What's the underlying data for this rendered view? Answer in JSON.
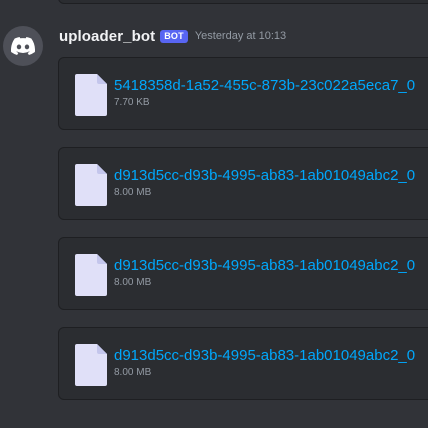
{
  "message": {
    "username": "uploader_bot",
    "bot_tag": "BOT",
    "timestamp": "Yesterday at 10:13",
    "avatar_icon": "discord-logo-icon",
    "attachments": [
      {
        "name": "5418358d-1a52-455c-873b-23c022a5eca7_0",
        "size": "7.70 KB",
        "icon": "file-icon"
      },
      {
        "name": "d913d5cc-d93b-4995-ab83-1ab01049abc2_0",
        "size": "8.00 MB",
        "icon": "file-icon"
      },
      {
        "name": "d913d5cc-d93b-4995-ab83-1ab01049abc2_0",
        "size": "8.00 MB",
        "icon": "file-icon"
      },
      {
        "name": "d913d5cc-d93b-4995-ab83-1ab01049abc2_0",
        "size": "8.00 MB",
        "icon": "file-icon"
      }
    ]
  },
  "colors": {
    "background": "#313338",
    "attachment_bg": "#2b2d31",
    "link": "#00a8fc",
    "bot_tag": "#5865f2",
    "muted": "#949ba4"
  }
}
